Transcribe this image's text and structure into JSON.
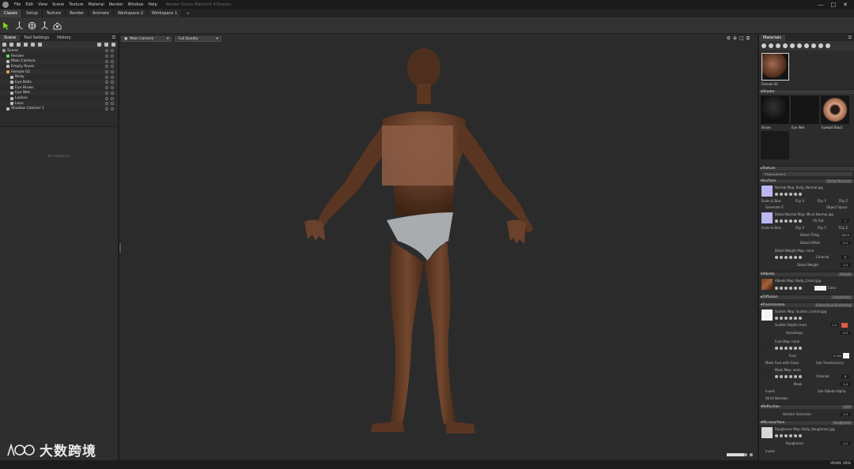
{
  "window": {
    "title": "Render Scene Maroon0 4/Scenes",
    "menu": [
      "File",
      "Edit",
      "View",
      "Scene",
      "Texture",
      "Material",
      "Render",
      "Window",
      "Help"
    ],
    "controls": [
      "—",
      "□",
      "✕"
    ]
  },
  "workspaces": {
    "tabs": [
      "Classic",
      "Setup",
      "Texture",
      "Render",
      "Animate",
      "Workspace 2",
      "Workspace 1"
    ],
    "active_index": 0,
    "add": "+"
  },
  "left_panel": {
    "tabs": [
      "Scene",
      "Tool Settings",
      "History"
    ],
    "active_tab": 0,
    "tree": [
      {
        "label": "Scene",
        "depth": 0,
        "color": "#9b9b9b"
      },
      {
        "label": "Render",
        "depth": 1,
        "color": "#6ad06a"
      },
      {
        "label": "Main Camera",
        "depth": 1,
        "color": "#bdbdbd"
      },
      {
        "label": "Empty Room",
        "depth": 1,
        "color": "#bdbdbd"
      },
      {
        "label": "Female 02",
        "depth": 1,
        "color": "#d6a64a"
      },
      {
        "label": "Body",
        "depth": 2,
        "color": "#bdbdbd"
      },
      {
        "label": "Eye Balls",
        "depth": 2,
        "color": "#bdbdbd"
      },
      {
        "label": "Eye Brows",
        "depth": 2,
        "color": "#bdbdbd"
      },
      {
        "label": "Eye Wet",
        "depth": 2,
        "color": "#bdbdbd"
      },
      {
        "label": "Lashes",
        "depth": 2,
        "color": "#bdbdbd"
      },
      {
        "label": "Lens",
        "depth": 2,
        "color": "#bdbdbd"
      },
      {
        "label": "Shadow Catcher 1",
        "depth": 1,
        "color": "#bdbdbd"
      }
    ],
    "empty_message": "No Selection"
  },
  "viewport": {
    "camera": "Main Camera",
    "quality": "Full Quality",
    "render_progress": 0.85
  },
  "right_panel": {
    "tabs": [
      "Materials"
    ],
    "selected_material": "Female 02",
    "shaders_header": "Shader",
    "shaders": [
      "Brows",
      "Eye Wet",
      "Eyeball Black"
    ],
    "texture_header": "Texture",
    "texture_mode": "Displacement",
    "surface": {
      "header": "Surface",
      "mode": "Detail Normals",
      "normal_map": "Normal Map: Body_Normal.jpg",
      "scale_bias": "Scale & Bias",
      "flip_x": "Flip X",
      "flip_y": "Flip Y",
      "flip_z": "Flip Z",
      "generate": "Generate Z",
      "object_space": "Object Space",
      "detail_normal_map": "Detail Normal Map: Micro Normal.jpg",
      "uv_set": "UV Set",
      "uv_val": "1",
      "detail_tiling_label": "Detail Tiling",
      "detail_tiling": "100.0",
      "detail_offset_label": "Detail Offset",
      "detail_offset": "0.0",
      "detail_weight_map": "Detail Weight Map: none",
      "channel": "Channel",
      "channel_val": "R",
      "detail_weight_label": "Detail Weight",
      "detail_weight": "1.0"
    },
    "albedo": {
      "header": "Albedo",
      "mode": "Albedo",
      "map": "Albedo Map: Body_Colour.jpg",
      "color_label": "Color"
    },
    "diffusion": {
      "header": "Diffusion",
      "mode": "Lambertian"
    },
    "transmission": {
      "header": "Transmission",
      "mode": "Subsurface Scattering",
      "scatter_map": "Scatter Map: Scatter_Control.jpg",
      "scatter_depth_label": "Scatter Depth (mm)",
      "scatter_depth": "1.0",
      "anisotropy_label": "Anisotropy",
      "anisotropy": "0.0",
      "fuzz_map": "Fuzz Map: none",
      "fuzz_label": "Fuzz",
      "fuzz": "0.100",
      "mask_fuzz": "Mask Fuzz with Gloss",
      "use_translucency": "Use Translucency",
      "mask_map": "Mask Map: none",
      "channel": "Channel",
      "channel_val": "R",
      "mask_label": "Mask",
      "mask": "1.0",
      "invert": "Invert",
      "use_albedo_alpha": "Use Albedo Alpha",
      "strict_normals": "Strict Normals"
    },
    "reflection": {
      "header": "Reflection",
      "mode": "GGX",
      "horizon_label": "Horizon Occlusion",
      "horizon": "1.0"
    },
    "microsurface": {
      "header": "Microsurface",
      "mode": "Roughness",
      "roughness_map": "Roughness Map: Body_Roughness.jpg",
      "roughness_label": "Roughness",
      "roughness": "1.0",
      "invert": "Invert"
    }
  },
  "status": {
    "right": "VRAM: 49%"
  },
  "watermark": {
    "text": "大数跨境"
  }
}
